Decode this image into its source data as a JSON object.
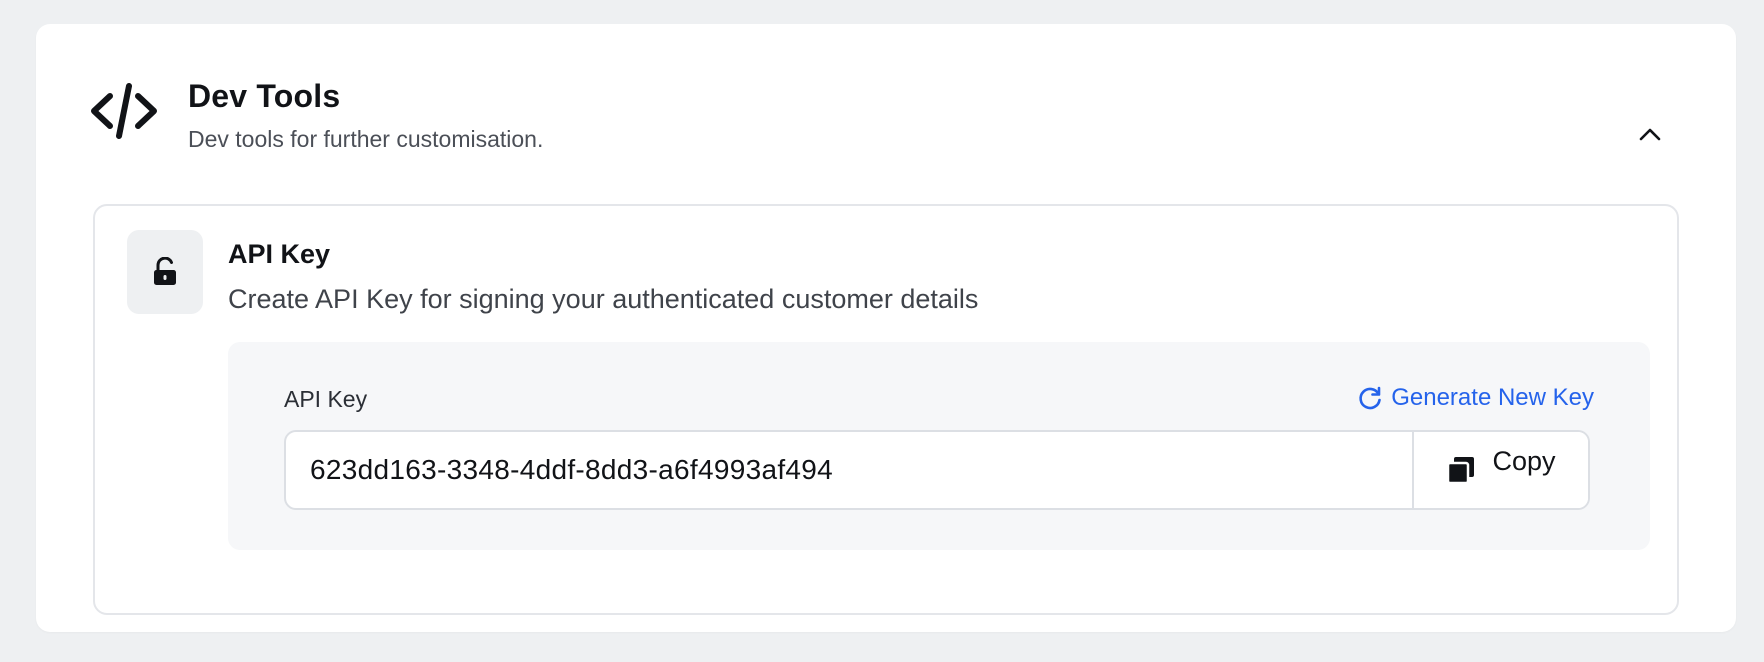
{
  "section": {
    "title": "Dev Tools",
    "description": "Dev tools for further customisation.",
    "icon": "code-icon",
    "collapse_icon": "chevron-up-icon"
  },
  "api_key_card": {
    "icon": "unlock-icon",
    "title": "API Key",
    "description": "Create API Key for signing your authenticated customer details",
    "field_label": "API Key",
    "generate_label": "Generate New Key",
    "generate_icon": "refresh-icon",
    "key_value": "623dd163-3348-4ddf-8dd3-a6f4993af494",
    "copy_label": "Copy",
    "copy_icon": "copy-icon"
  },
  "colors": {
    "background": "#eef0f2",
    "card": "#ffffff",
    "link": "#2563eb",
    "panel": "#f6f7f9"
  }
}
